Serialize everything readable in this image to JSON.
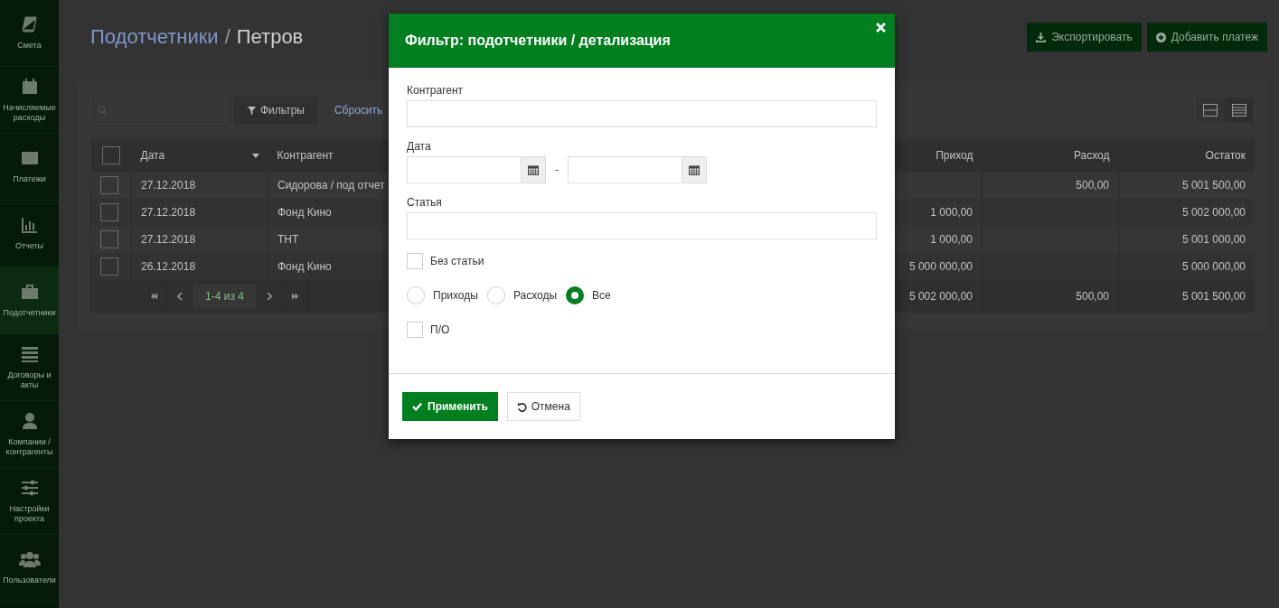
{
  "sidebar": {
    "items": [
      {
        "label": "Смета",
        "selected": false
      },
      {
        "label": "Начисляемые расходы",
        "selected": false
      },
      {
        "label": "Платежи",
        "selected": false
      },
      {
        "label": "Отчеты",
        "selected": false
      },
      {
        "label": "Подотчетники",
        "selected": true
      },
      {
        "label": "Договоры и акты",
        "selected": false
      },
      {
        "label": "Компании / контрагенты",
        "selected": false
      },
      {
        "label": "Настройки проекта",
        "selected": false
      },
      {
        "label": "Пользователи",
        "selected": false
      }
    ]
  },
  "header": {
    "breadcrumb_link": "Подотчетники",
    "separator": "/",
    "title": "Петров",
    "buttons": [
      {
        "label": "Экспортировать"
      },
      {
        "label": "Добавить платеж"
      }
    ]
  },
  "toolbar": {
    "filters_button": "Фильтры",
    "reset_link": "Сбросить"
  },
  "table": {
    "select_all_checked": false,
    "columns": [
      {
        "label": "Дата",
        "sorted": true
      },
      {
        "label": "Контрагент",
        "sorted": false
      },
      {
        "label": "Приход",
        "sorted": false
      },
      {
        "label": "Расход",
        "sorted": false
      },
      {
        "label": "Остаток",
        "sorted": false
      }
    ],
    "rows": [
      {
        "checked": false,
        "cells": [
          "27.12.2018",
          "Сидорова / под отчет",
          "",
          "500,00",
          "5 001 500,00"
        ]
      },
      {
        "checked": false,
        "cells": [
          "27.12.2018",
          "Фонд Кино",
          "1 000,00",
          "",
          "5 002 000,00"
        ]
      },
      {
        "checked": false,
        "cells": [
          "27.12.2018",
          "ТНТ",
          "1 000,00",
          "",
          "5 001 000,00"
        ]
      },
      {
        "checked": false,
        "cells": [
          "26.12.2018",
          "Фонд Кино",
          "5 000 000,00",
          "",
          "5 000 000,00"
        ]
      }
    ],
    "pagination": "1-4 из 4",
    "totals": [
      "5 002 000,00",
      "500,00",
      "5 001 500,00"
    ]
  },
  "dialog": {
    "title": "Фильтр: подотчетники / детализация",
    "counterparty_label": "Контрагент",
    "date_label": "Дата",
    "date_separator": "-",
    "article_label": "Статья",
    "no_article": {
      "label": "Без статьи",
      "checked": false
    },
    "radios": [
      {
        "label": "Приходы",
        "selected": false
      },
      {
        "label": "Расходы",
        "selected": false
      },
      {
        "label": "Все",
        "selected": true
      }
    ],
    "po": {
      "label": "П/О",
      "checked": false
    },
    "apply_button": "Применить",
    "cancel_button": "Отмена"
  }
}
